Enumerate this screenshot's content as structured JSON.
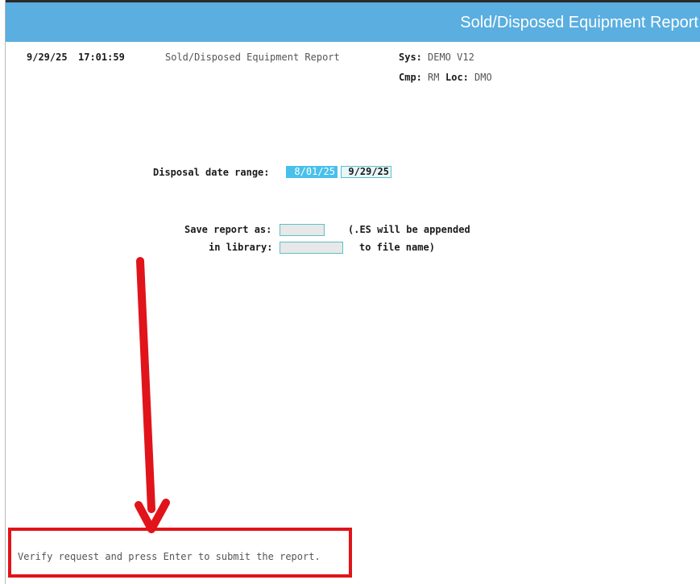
{
  "window": {
    "title": "Sold/Disposed Equipment Report"
  },
  "header": {
    "date": "9/29/25",
    "time": "17:01:59",
    "report_name": "Sold/Disposed Equipment Report",
    "sys_label": "Sys:",
    "sys_value": "DEMO V12",
    "cmp_label": "Cmp:",
    "cmp_value": "RM",
    "loc_label": "Loc:",
    "loc_value": "DMO"
  },
  "form": {
    "disposal_label": "Disposal date range:",
    "date_from": "8/01/25",
    "date_to": "9/29/25",
    "save_label": "Save report as:",
    "save_value": "",
    "library_label": "in library:",
    "library_value": "",
    "note_line1": "(.ES will be appended",
    "note_line2": "to file name)"
  },
  "status": {
    "message": "Verify request and press Enter to submit the report."
  },
  "annotation": {
    "color": "#e0141a"
  }
}
